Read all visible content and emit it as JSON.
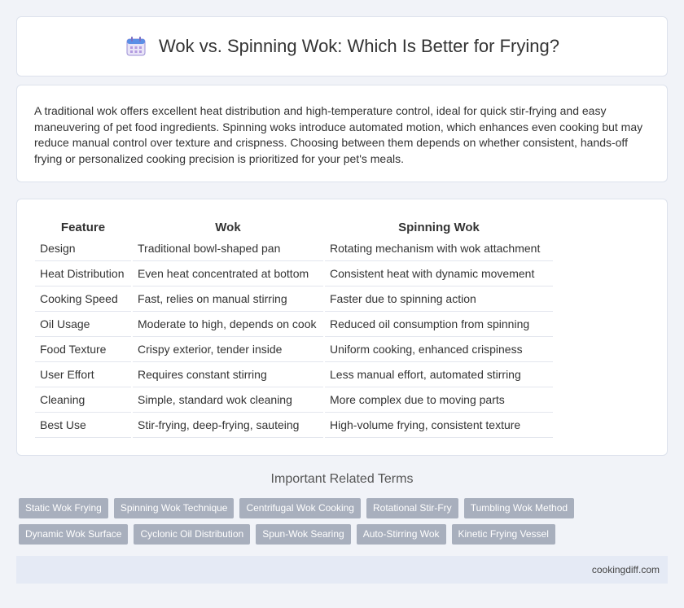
{
  "header": {
    "title": "Wok vs. Spinning Wok: Which Is Better for Frying?",
    "icon": "calendar-icon"
  },
  "intro": {
    "text": "A traditional wok offers excellent heat distribution and high-temperature control, ideal for quick stir-frying and easy maneuvering of pet food ingredients. Spinning woks introduce automated motion, which enhances even cooking but may reduce manual control over texture and crispness. Choosing between them depends on whether consistent, hands-off frying or personalized cooking precision is prioritized for your pet's meals."
  },
  "table": {
    "headers": [
      "Feature",
      "Wok",
      "Spinning Wok"
    ],
    "rows": [
      [
        "Design",
        "Traditional bowl-shaped pan",
        "Rotating mechanism with wok attachment"
      ],
      [
        "Heat Distribution",
        "Even heat concentrated at bottom",
        "Consistent heat with dynamic movement"
      ],
      [
        "Cooking Speed",
        "Fast, relies on manual stirring",
        "Faster due to spinning action"
      ],
      [
        "Oil Usage",
        "Moderate to high, depends on cook",
        "Reduced oil consumption from spinning"
      ],
      [
        "Food Texture",
        "Crispy exterior, tender inside",
        "Uniform cooking, enhanced crispiness"
      ],
      [
        "User Effort",
        "Requires constant stirring",
        "Less manual effort, automated stirring"
      ],
      [
        "Cleaning",
        "Simple, standard wok cleaning",
        "More complex due to moving parts"
      ],
      [
        "Best Use",
        "Stir-frying, deep-frying, sauteing",
        "High-volume frying, consistent texture"
      ]
    ]
  },
  "related": {
    "title": "Important Related Terms",
    "tags_row1": [
      "Static Wok Frying",
      "Spinning Wok Technique",
      "Centrifugal Wok Cooking",
      "Rotational Stir-Fry",
      "Tumbling Wok Method"
    ],
    "tags_row2": [
      "Dynamic Wok Surface",
      "Cyclonic Oil Distribution",
      "Spun-Wok Searing",
      "Auto-Stirring Wok",
      "Kinetic Frying Vessel"
    ]
  },
  "footer": {
    "site": "cookingdiff.com"
  }
}
